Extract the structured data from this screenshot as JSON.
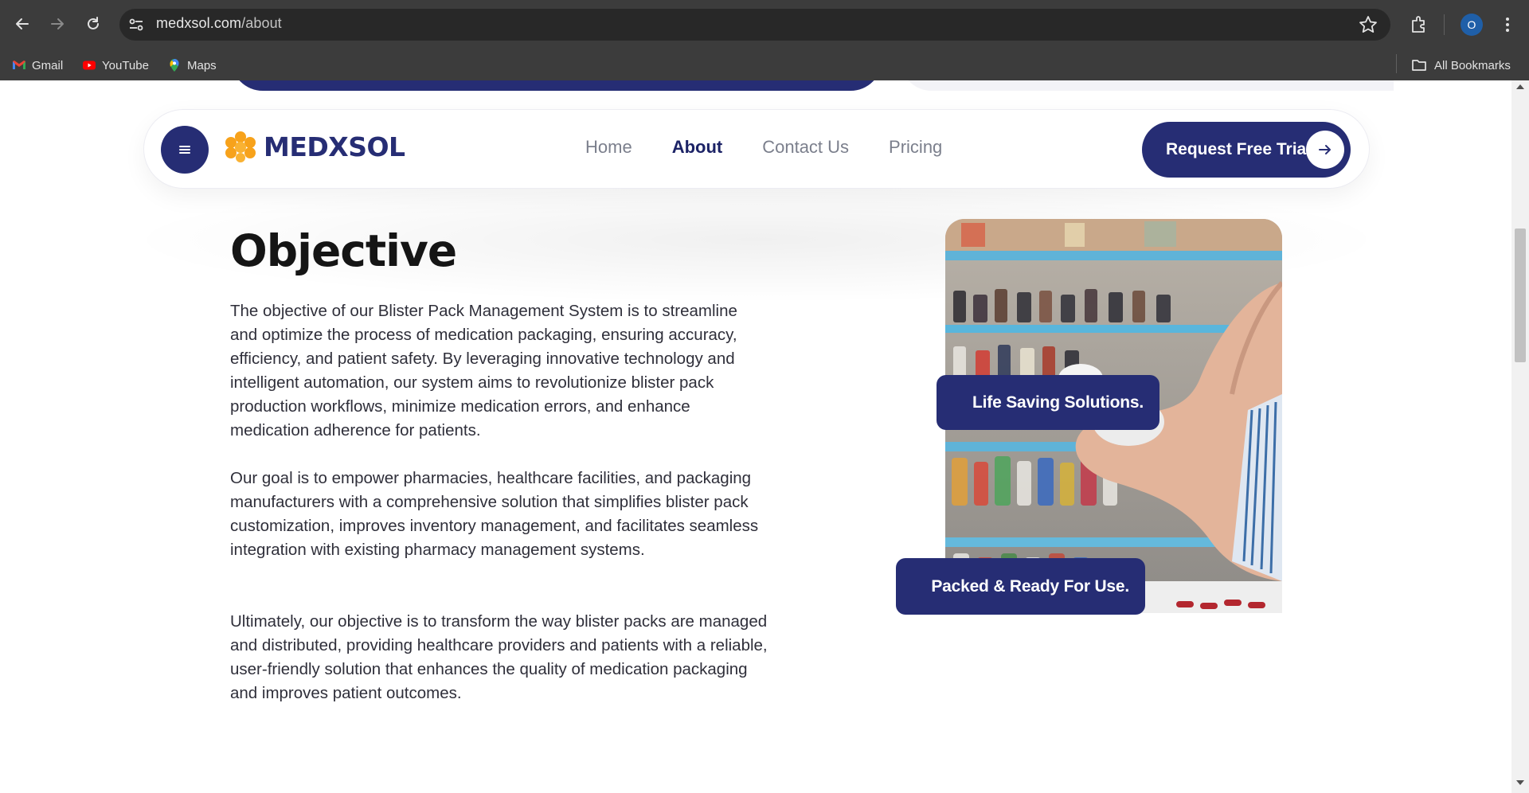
{
  "browser": {
    "url_domain": "medxsol.com",
    "url_path": "/about",
    "profile_initial": "O",
    "bookmarks": [
      {
        "label": "Gmail",
        "icon": "gmail-icon"
      },
      {
        "label": "YouTube",
        "icon": "youtube-icon"
      },
      {
        "label": "Maps",
        "icon": "maps-icon"
      }
    ],
    "all_bookmarks_label": "All Bookmarks"
  },
  "nav": {
    "brand": "MEDXSOL",
    "links": [
      "Home",
      "About",
      "Contact Us",
      "Pricing"
    ],
    "active_link": "About",
    "cta_label": "Request Free Trial"
  },
  "main": {
    "title": "Objective",
    "paragraphs": [
      "The objective of our Blister Pack Management System is to streamline and optimize the process of medication packaging, ensuring accuracy, efficiency, and patient safety. By leveraging innovative technology and intelligent automation, our system aims to revolutionize blister pack production workflows, minimize medication errors, and enhance medication adherence for patients.",
      "Our goal is to empower pharmacies, healthcare facilities, and packaging manufacturers with a comprehensive solution that simplifies blister pack customization, improves inventory management, and facilitates seamless integration with existing pharmacy management systems.",
      "Ultimately, our objective is to transform the way blister packs are managed and distributed, providing healthcare providers and patients with a reliable, user-friendly solution that enhances the quality of medication packaging and improves patient outcomes."
    ],
    "badges": [
      "Life Saving Solutions.",
      "Packed & Ready For Use."
    ]
  },
  "colors": {
    "brand_navy": "#262d74",
    "logo_orange": "#f7a21b",
    "body_text": "#2f2f3a"
  }
}
